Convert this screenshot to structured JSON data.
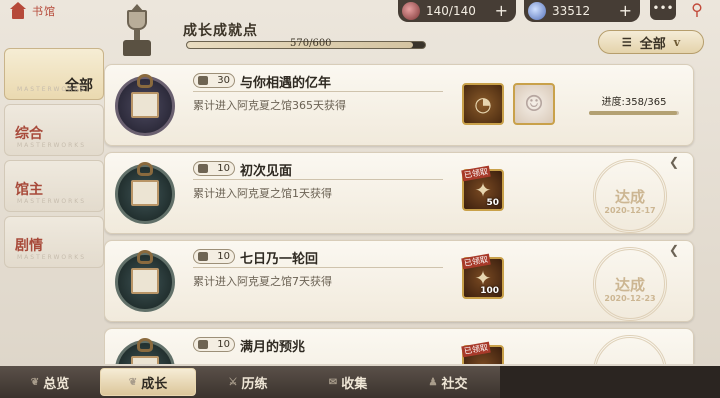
{
  "header": {
    "home_label": "书馆",
    "growth_title": "成长成就点",
    "growth_points": "570/600",
    "growth_fraction": 0.95,
    "resources": [
      {
        "name": "stamina",
        "value": "140/140",
        "plus": "+"
      },
      {
        "name": "gem",
        "value": "33512",
        "plus": "+"
      }
    ],
    "chat_icon": "•••",
    "location_icon": "⚲",
    "filter": {
      "label": "全部",
      "icon": "☰",
      "chevron": "v"
    }
  },
  "sidebar": {
    "items": [
      {
        "label": "全部",
        "watermark": "MASTERWORKS"
      },
      {
        "label": "综合",
        "watermark": "MASTERWORKS"
      },
      {
        "label": "馆主",
        "watermark": "MASTERWORKS"
      },
      {
        "label": "剧情",
        "watermark": "MASTERWORKS"
      }
    ]
  },
  "achievements": [
    {
      "points": "30",
      "title": "与你相遇的亿年",
      "desc": "累计进入阿克夏之馆365天获得",
      "progress_label": "进度:358/365",
      "progress_fraction": 0.98,
      "rewards": [
        {
          "type": "item",
          "icon": "compass-icon",
          "glyph": "◔"
        },
        {
          "type": "avatar",
          "icon": "character-portrait-icon",
          "glyph": "☺"
        }
      ]
    },
    {
      "points": "10",
      "title": "初次见面",
      "desc": "累计进入阿克夏之馆1天获得",
      "stamp_title": "达成",
      "stamp_date": "2020-12-17",
      "reward": {
        "qty": "50",
        "claimed": "已领取",
        "glyph": "✦"
      }
    },
    {
      "points": "10",
      "title": "七日乃一轮回",
      "desc": "累计进入阿克夏之馆7天获得",
      "stamp_title": "达成",
      "stamp_date": "2020-12-23",
      "reward": {
        "qty": "100",
        "claimed": "已领取",
        "glyph": "✦"
      }
    },
    {
      "points": "10",
      "title": "满月的预兆",
      "desc": "",
      "reward": {
        "claimed": "已领取"
      }
    }
  ],
  "bottom_nav": [
    {
      "label": "总览",
      "active": false,
      "icon": "❦"
    },
    {
      "label": "成长",
      "active": true,
      "icon": "❦"
    },
    {
      "label": "历练",
      "active": false,
      "icon": "⚔"
    },
    {
      "label": "收集",
      "active": false,
      "icon": "✉"
    },
    {
      "label": "社交",
      "active": false,
      "icon": "♟"
    }
  ],
  "colors": {
    "accent_red": "#b64a3a",
    "gold": "#c9a14a",
    "dark": "#463d35"
  }
}
